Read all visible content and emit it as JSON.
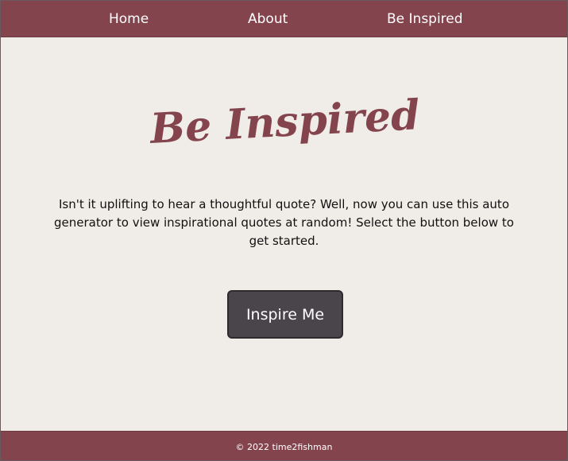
{
  "nav": {
    "home_label": "Home",
    "about_label": "About",
    "inspired_label": "Be Inspired"
  },
  "hero": {
    "title": "Be Inspired",
    "intro_text": "Isn't it uplifting to hear a thoughtful quote? Well, now you can use this auto generator to view inspirational quotes at random! Select the button below to get started."
  },
  "actions": {
    "inspire_label": "Inspire Me"
  },
  "footer": {
    "copyright": "© 2022 time2fishman"
  },
  "colors": {
    "brand": "#84444d",
    "background": "#f0ece7",
    "button": "#4a444b",
    "text": "#111111"
  }
}
